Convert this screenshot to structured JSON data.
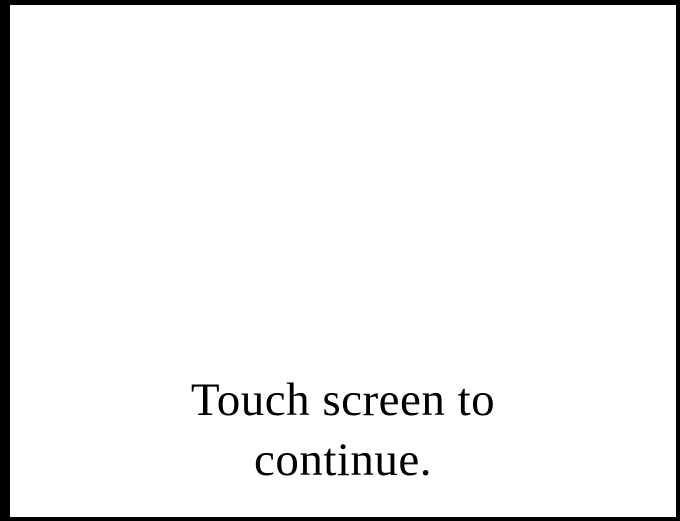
{
  "prompt": {
    "line1": "Touch screen to",
    "line2": "continue."
  },
  "colors": {
    "background": "#ffffff",
    "border": "#000000",
    "text": "#000000"
  }
}
